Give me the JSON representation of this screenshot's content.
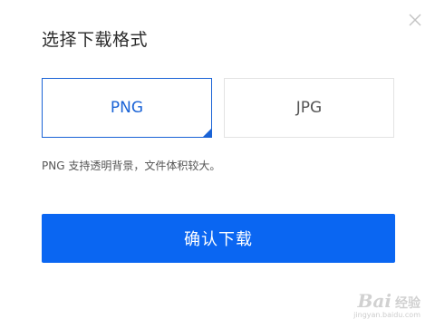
{
  "dialog": {
    "title": "选择下载格式",
    "close_icon": "close-icon",
    "options": [
      {
        "label": "PNG",
        "selected": true
      },
      {
        "label": "JPG",
        "selected": false
      }
    ],
    "description": "PNG 支持透明背景，文件体积较大。",
    "confirm_label": "确认下载"
  },
  "watermark": {
    "brand": "Bai",
    "brand_suffix": "经验",
    "url": "jingyan.baidu.com"
  },
  "colors": {
    "accent": "#0a66f2",
    "selected_border": "#1a63d6",
    "border": "#e3e3e3",
    "text": "#2b2b2b"
  }
}
